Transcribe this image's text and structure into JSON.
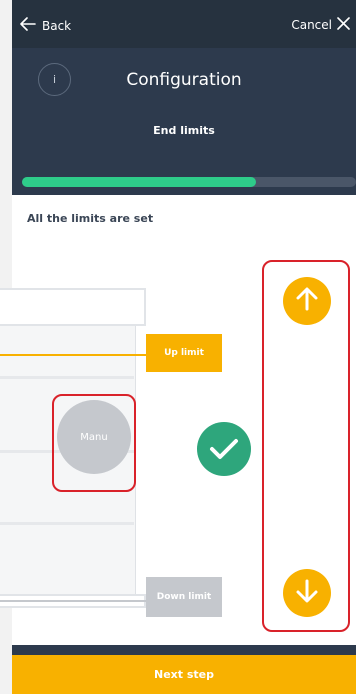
{
  "nav": {
    "back_label": "Back",
    "cancel_label": "Cancel"
  },
  "header": {
    "info_label": "i",
    "title": "Configuration",
    "subtitle": "End limits"
  },
  "progress": {
    "value": 0.7
  },
  "card": {
    "heading": "All the limits are set",
    "up_limit_label": "Up limit",
    "down_limit_label": "Down limit",
    "manual_button_label": "Manu"
  },
  "footer": {
    "next_label": "Next step"
  },
  "colors": {
    "background": "#2d3a4d",
    "accent": "#f8b100",
    "progress": "#2ecc8a",
    "success": "#2ea67c",
    "highlight": "#d9222a",
    "inactive": "#c5c8cd"
  },
  "icons": {
    "back": "arrow-left-icon",
    "cancel": "close-icon",
    "info": "info-icon",
    "success": "check-icon",
    "up": "arrow-up-icon",
    "down": "arrow-down-icon"
  }
}
